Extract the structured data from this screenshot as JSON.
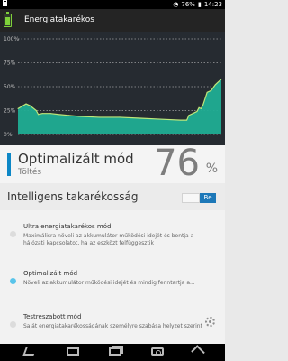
{
  "status_bar": {
    "notification_icon": "battery-level-icon",
    "wifi_icon": "wifi-icon",
    "battery_percent": "76%",
    "battery_icon": "battery-status-icon",
    "time": "14:23"
  },
  "app_bar": {
    "icon": "battery-app-icon",
    "title": "Energiatakarékos"
  },
  "chart_data": {
    "type": "area",
    "ylim": [
      0,
      100
    ],
    "y_tick_labels": [
      "100%",
      "75%",
      "50%",
      "25%",
      "0%"
    ],
    "grid": true,
    "colors": {
      "background": "#262b31",
      "area": "#1fad93",
      "line": "#bfe77a",
      "grid": "#d9d9d9"
    },
    "x": [
      0,
      0.04,
      0.06,
      0.09,
      0.1,
      0.12,
      0.16,
      0.2,
      0.25,
      0.3,
      0.4,
      0.5,
      0.6,
      0.7,
      0.8,
      0.83,
      0.84,
      0.86,
      0.88,
      0.89,
      0.9,
      0.91,
      0.93,
      0.95,
      0.97,
      1.0
    ],
    "y": [
      27,
      32,
      30,
      25,
      21,
      22,
      22,
      21,
      20,
      19,
      18,
      18,
      17,
      16,
      15,
      15,
      20,
      22,
      24,
      28,
      27,
      31,
      44,
      46,
      52,
      58
    ]
  },
  "battery_status": {
    "mode_title": "Optimalizált mód",
    "state": "Töltés",
    "percent": "76",
    "percent_sign": "%"
  },
  "section": {
    "title": "Intelligens takarékosság",
    "toggle_label": "Be",
    "toggle_on": true
  },
  "modes": [
    {
      "title": "Ultra energiatakarékos mód",
      "description": "Maximálisra növeli az akkumulátor működési idejét és bontja a hálózati kapcsolatot, ha az eszközt felfüggesztik",
      "selected": false
    },
    {
      "title": "Optimalizált mód",
      "description": "Növeli az akkumulátor működési idejét és mindig fenntartja a...",
      "selected": true
    },
    {
      "title": "Testreszabott mód",
      "description": "Saját energiatakarékosságának személyre szabása helyzet szerint",
      "selected": false,
      "settings_icon": "gear-icon"
    }
  ],
  "nav_bar": {
    "back_icon": "back-icon",
    "home_icon": "home-icon",
    "recent_icon": "recent-apps-icon",
    "camera_icon": "camera-icon",
    "up_icon": "up-icon"
  }
}
